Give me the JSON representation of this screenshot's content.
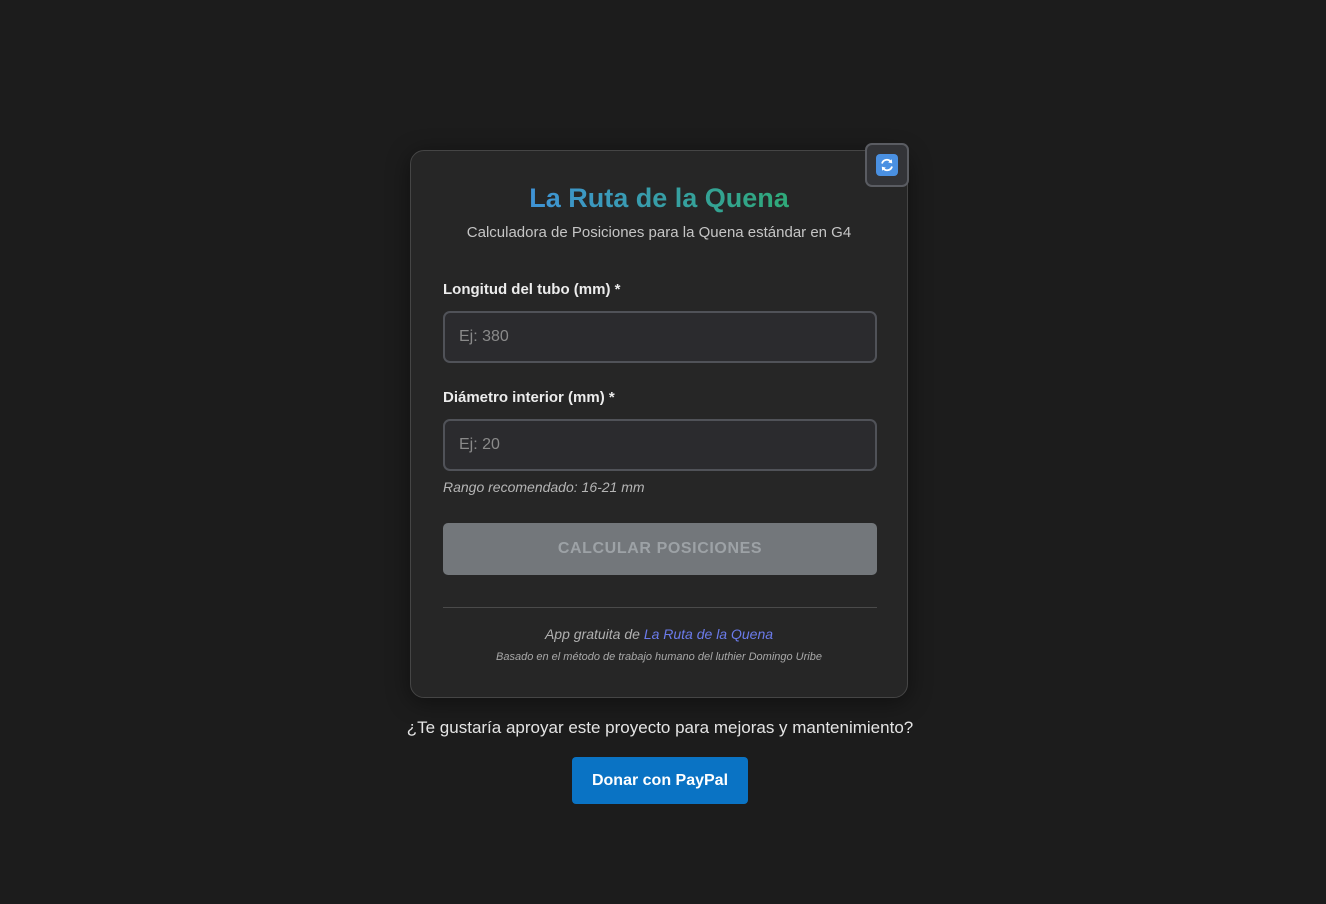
{
  "app": {
    "title": "La Ruta de la Quena",
    "subtitle": "Calculadora de Posiciones para la Quena estándar en G4",
    "reset_icon": "refresh-arrows-icon"
  },
  "form": {
    "length": {
      "label": "Longitud del tubo (mm) *",
      "placeholder": "Ej: 380",
      "value": ""
    },
    "diameter": {
      "label": "Diámetro interior (mm) *",
      "placeholder": "Ej: 20",
      "value": "",
      "hint": "Rango recomendado: 16-21 mm"
    },
    "submit_label": "Calcular posiciones"
  },
  "footer": {
    "credit_prefix": "App gratuita de",
    "credit_link": "La Ruta de la Quena",
    "method": "Basado en el método de trabajo humano del luthier Domingo Uribe"
  },
  "support": {
    "question": "¿Te gustaría aproyar este proyecto para mejoras y mantenimiento?",
    "donate_label": "Donar con PayPal"
  },
  "colors": {
    "background": "#1c1c1c",
    "card": "#262626",
    "title_gradient_start": "#3f93d6",
    "title_gradient_end": "#2fa978",
    "link": "#6b7bea",
    "paypal": "#0a73c4",
    "disabled_button": "#73777b"
  }
}
